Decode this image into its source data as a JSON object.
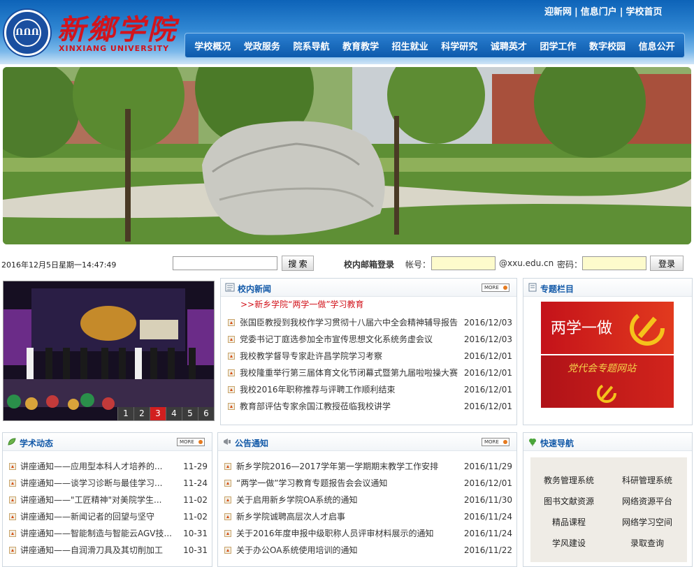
{
  "header": {
    "logo_cn": "新鄉学院",
    "logo_en": "XINXIANG UNIVERSITY",
    "seal_text": "ՈՈՈ",
    "top_links": [
      "迎新网",
      "信息门户",
      "学校首页"
    ],
    "nav": [
      "学校概况",
      "党政服务",
      "院系导航",
      "教育教学",
      "招生就业",
      "科学研究",
      "诚聘英才",
      "团学工作",
      "数字校园",
      "信息公开"
    ]
  },
  "bar": {
    "datetime": "2016年12月5日星期一14:47:49",
    "search_button": "搜 索",
    "mail_label": "校内邮箱登录",
    "account_label": "帐号：",
    "domain": "@xxu.edu.cn",
    "password_label": "密码：",
    "login_button": "登录"
  },
  "slideshow": {
    "pages": [
      "1",
      "2",
      "3",
      "4",
      "5",
      "6"
    ],
    "active": 3
  },
  "campus_news": {
    "title": "校内新闻",
    "more": "MORE",
    "highlight": ">>新乡学院“两学一做”学习教育",
    "items": [
      {
        "title": "张国臣教授到我校作学习贯彻十八届六中全会精神辅导报告",
        "date": "2016/12/03"
      },
      {
        "title": "党委书记丁庭选参加全市宣传思想文化系统务虚会议",
        "date": "2016/12/03"
      },
      {
        "title": "我校教学督导专家赴许昌学院学习考察",
        "date": "2016/12/01"
      },
      {
        "title": "我校隆重举行第三届体育文化节闭幕式暨第九届啦啦操大赛",
        "date": "2016/12/01"
      },
      {
        "title": "我校2016年职称推荐与评聘工作顺利结束",
        "date": "2016/12/01"
      },
      {
        "title": "教育部评估专家余国江教授莅临我校讲学",
        "date": "2016/12/01"
      }
    ]
  },
  "topics": {
    "title": "专题栏目",
    "banner1": "两学一做",
    "banner2": "党代会专题网站"
  },
  "academic": {
    "title": "学术动态",
    "more": "MORE",
    "items": [
      {
        "title": "讲座通知——应用型本科人才培养的...",
        "date": "11-29"
      },
      {
        "title": "讲座通知——谈学习诊断与最佳学习...",
        "date": "11-24"
      },
      {
        "title": "讲座通知——\"工匠精神\"对美院学生...",
        "date": "11-02"
      },
      {
        "title": "讲座通知——新闻记者的回望与坚守",
        "date": "11-02"
      },
      {
        "title": "讲座通知——智能制造与智能云AGV技...",
        "date": "10-31"
      },
      {
        "title": "讲座通知——自润滑刀具及其切削加工",
        "date": "10-31"
      }
    ]
  },
  "notices": {
    "title": "公告通知",
    "more": "MORE",
    "items": [
      {
        "title": "新乡学院2016—2017学年第一学期期末教学工作安排",
        "date": "2016/11/29"
      },
      {
        "title": "“两学一做”学习教育专题报告会会议通知",
        "date": "2016/12/01"
      },
      {
        "title": "关于启用新乡学院OA系统的通知",
        "date": "2016/11/30"
      },
      {
        "title": "新乡学院诚聘高层次人才启事",
        "date": "2016/11/24"
      },
      {
        "title": "关于2016年度申报中级职称人员评审材料展示的通知",
        "date": "2016/11/24"
      },
      {
        "title": "关于办公OA系统使用培训的通知",
        "date": "2016/11/22"
      }
    ]
  },
  "quicknav": {
    "title": "快速导航",
    "links": [
      "教务管理系统",
      "科研管理系统",
      "图书文献资源",
      "网络资源平台",
      "精品课程",
      "网络学习空间",
      "学风建设",
      "录取查询"
    ]
  },
  "colors": {
    "accent": "#1259a8",
    "nav_bg": "#0d5aac",
    "brand_red": "#d2141c"
  }
}
